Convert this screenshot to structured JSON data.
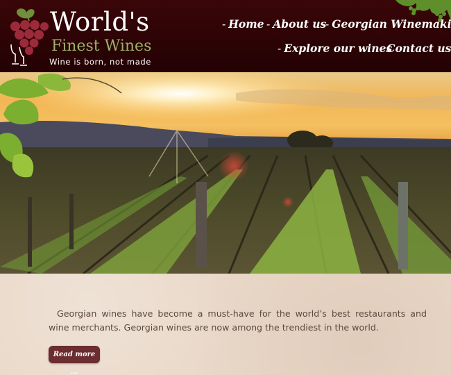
{
  "brand": {
    "title": "World's",
    "subtitle": "Finest Wines",
    "tagline": "Wine is born, not made"
  },
  "nav": {
    "items": [
      {
        "label": "Home"
      },
      {
        "label": "About us"
      },
      {
        "label": "Georgian Winemaking"
      },
      {
        "label": "Explore our wines"
      },
      {
        "label": "Contact us"
      }
    ]
  },
  "main": {
    "intro": "Georgian wines have become a must-have for the world’s best restaurants and wine merchants. Georgian wines are now among the trendiest in the world.",
    "read_more_label": "Read more ..."
  },
  "colors": {
    "header_bg": "#2c0305",
    "brand_green": "#9bb06a",
    "button_bg": "#6b2d2f",
    "content_bg": "#e9d8c8"
  }
}
